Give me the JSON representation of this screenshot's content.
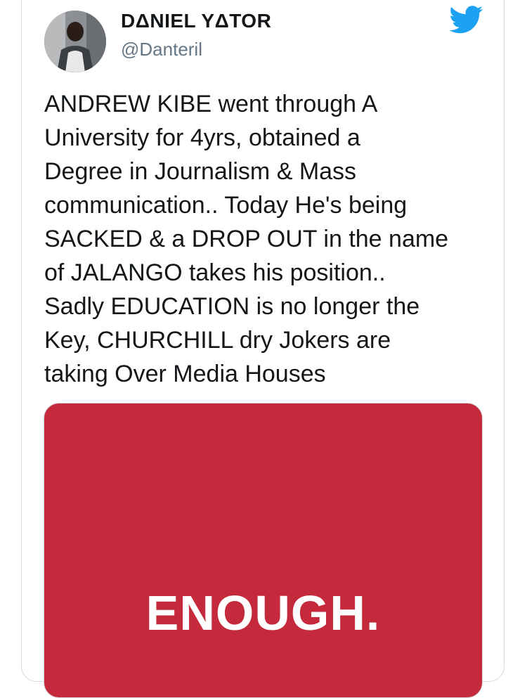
{
  "tweet": {
    "author": {
      "display_name": "DΔNIEL YΔTOR",
      "handle": "@Danteril",
      "avatar_icon": "profile-photo"
    },
    "platform_icon": "twitter-bird-icon",
    "text": "ANDREW KIBE went through A\nUniversity for 4yrs, obtained a\nDegree in Journalism & Mass\ncommunication.. Today He's being\nSACKED & a DROP OUT in the name\nof JALANGO takes his position..\nSadly EDUCATION is no longer the\nKey, CHURCHILL dry Jokers are\ntaking Over Media Houses",
    "media": {
      "text": "ENOUGH."
    }
  },
  "colors": {
    "twitter_blue": "#1da1f2",
    "text": "#14171a",
    "secondary_text": "#657786",
    "media_background": "#c42a3b",
    "border": "#d4d9dd"
  }
}
